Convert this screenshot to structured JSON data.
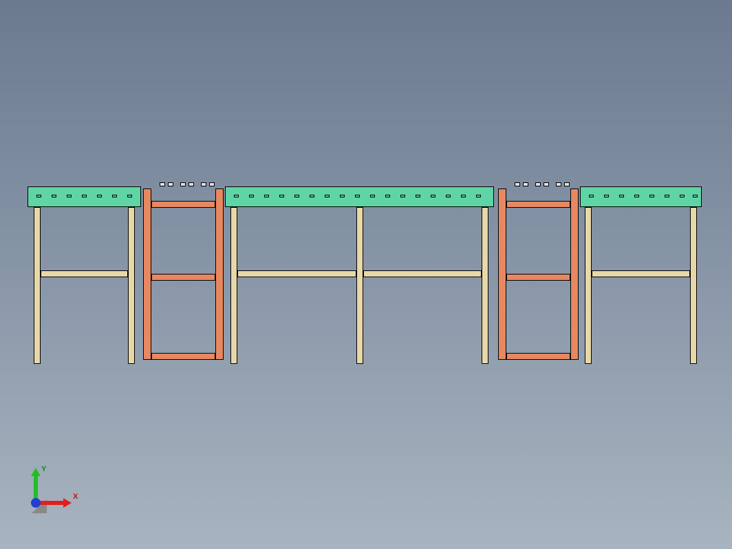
{
  "axis": {
    "x_label": "X",
    "y_label": "Y"
  },
  "model": {
    "type": "structural-assembly-front-view",
    "colors": {
      "beam": "#5fd4a5",
      "leg": "#e8d8a8",
      "frame": "#e88860"
    }
  }
}
